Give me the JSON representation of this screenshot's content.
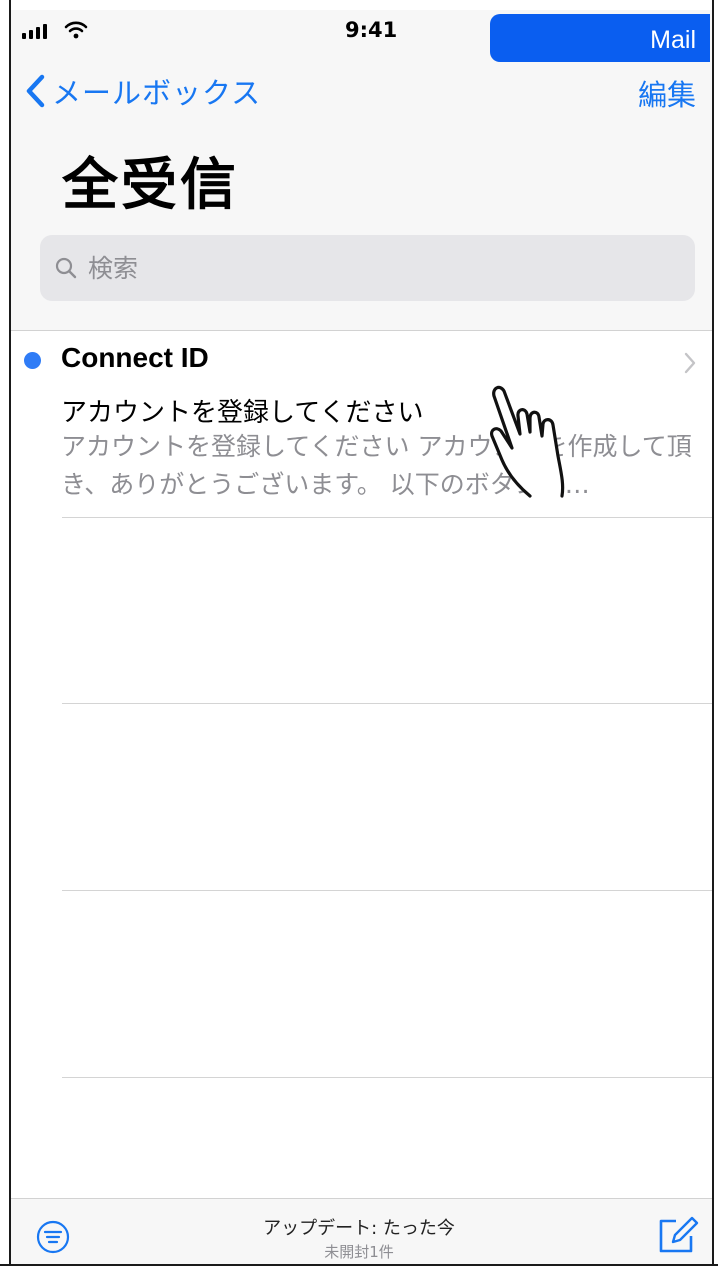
{
  "status_bar": {
    "time": "9:41",
    "active_app": "Mail"
  },
  "nav": {
    "back_label": "メールボックス",
    "edit_label": "編集"
  },
  "page": {
    "title": "全受信"
  },
  "search": {
    "placeholder": "検索"
  },
  "messages": [
    {
      "sender": "Connect ID",
      "subject": "アカウントを登録してください",
      "preview": "アカウントを登録してください アカウントを作成して頂き、ありがとうございます。 以下のボタンを…",
      "unread": true
    }
  ],
  "toolbar": {
    "update_status": "アップデート: たった今",
    "unread_count": "未開封1件"
  },
  "colors": {
    "accent": "#1877f2",
    "unread_dot": "#2f7cf6",
    "mail_pill": "#0a5ef0"
  },
  "icons": [
    "signal-icon",
    "wifi-icon",
    "back-chevron-icon",
    "search-icon",
    "chevron-right-icon",
    "hand-pointer-icon",
    "filter-icon",
    "compose-icon"
  ]
}
